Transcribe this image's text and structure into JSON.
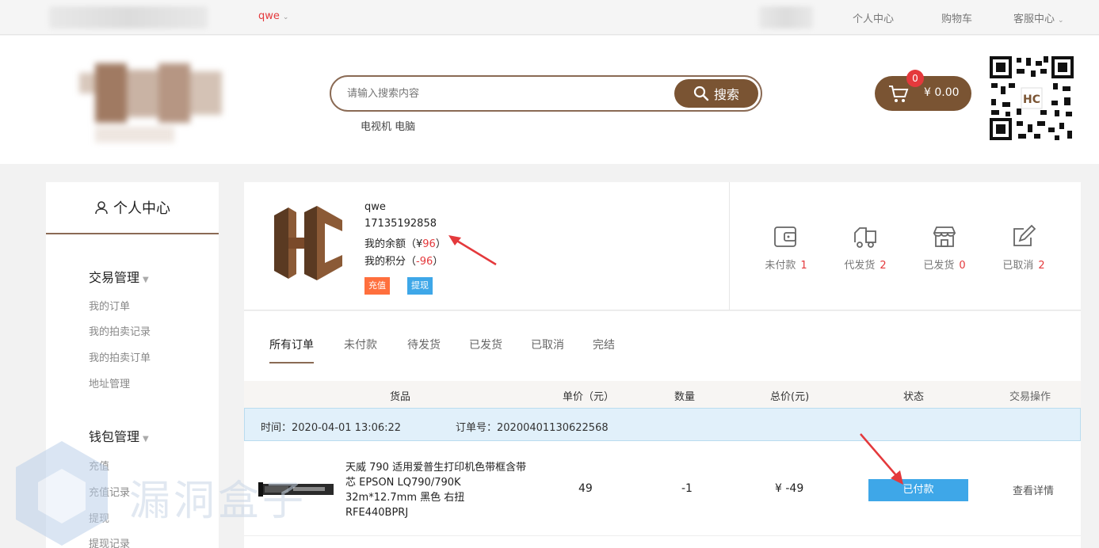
{
  "topbar": {
    "username": "qwe",
    "links": [
      "个人中心",
      "购物车",
      "客服中心"
    ]
  },
  "header": {
    "search_placeholder": "请输入搜索内容",
    "search_button": "搜索",
    "hot_words": "电视机 电脑",
    "cart_count": "0",
    "cart_amount": "¥ 0.00"
  },
  "sidebar": {
    "title": "个人中心",
    "groups": [
      {
        "label": "交易管理",
        "items": [
          "我的订单",
          "我的拍卖记录",
          "我的拍卖订单",
          "地址管理"
        ]
      },
      {
        "label": "钱包管理",
        "items": [
          "充值",
          "充值记录",
          "提现",
          "提现记录"
        ]
      }
    ]
  },
  "user": {
    "name": "qwe",
    "phone": "17135192858",
    "balance_label": "我的余额（¥",
    "balance_value": "96",
    "balance_close": "）",
    "points_label": "我的积分（",
    "points_value": "-96",
    "points_close": "）",
    "recharge": "充值",
    "withdraw": "提现",
    "stats": [
      {
        "label": "未付款",
        "count": "1"
      },
      {
        "label": "代发货",
        "count": "2"
      },
      {
        "label": "已发货",
        "count": "0"
      },
      {
        "label": "已取消",
        "count": "2"
      }
    ]
  },
  "orders": {
    "tabs": [
      "所有订单",
      "未付款",
      "待发货",
      "已发货",
      "已取消",
      "完结"
    ],
    "columns": [
      "货品",
      "单价（元）",
      "数量",
      "总价(元)",
      "状态",
      "交易操作"
    ],
    "order_time": "时间：2020-04-01 13:06:22",
    "order_no": "订单号：20200401130622568",
    "item": {
      "name": "天威 790 适用爱普生打印机色带框含带芯 EPSON LQ790/790K 32m*12.7mm 黑色 右扭 RFE440BPRJ",
      "unit_price": "49",
      "quantity": "-1",
      "total": "¥ -49",
      "status": "已付款",
      "action": "查看详情"
    }
  },
  "watermark": "漏洞盒子",
  "colors": {
    "brand": "#7a5433",
    "accent_red": "#e4393c",
    "status_blue": "#3ea7e8"
  }
}
